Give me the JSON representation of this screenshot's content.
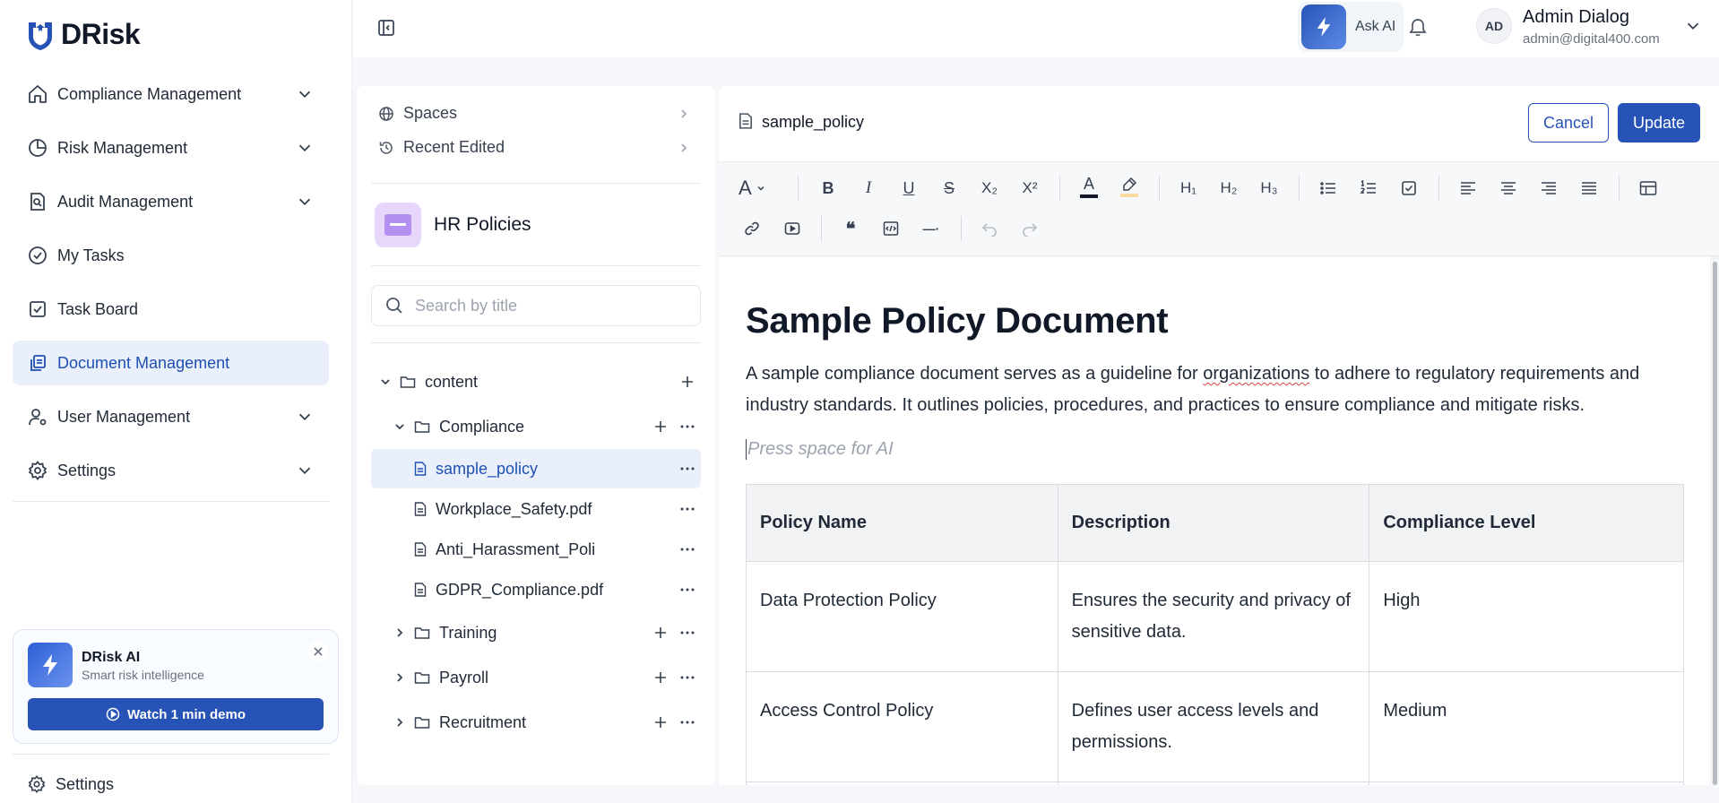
{
  "app": {
    "logo_text": "DRisk"
  },
  "sidebar": {
    "items": [
      {
        "label": "Compliance Management",
        "icon": "home-icon",
        "expandable": true
      },
      {
        "label": "Risk Management",
        "icon": "pie-chart-icon",
        "expandable": true
      },
      {
        "label": "Audit Management",
        "icon": "audit-search-icon",
        "expandable": true
      },
      {
        "label": "My Tasks",
        "icon": "check-circle-icon",
        "expandable": false
      },
      {
        "label": "Task Board",
        "icon": "checkbox-icon",
        "expandable": false
      },
      {
        "label": "Document Management",
        "icon": "documents-icon",
        "expandable": false,
        "active": true
      },
      {
        "label": "User Management",
        "icon": "user-gear-icon",
        "expandable": true
      },
      {
        "label": "Settings",
        "icon": "gear-icon",
        "expandable": true
      }
    ],
    "ai_card": {
      "title": "DRisk AI",
      "subtitle": "Smart risk intelligence",
      "button_label": "Watch 1 min demo"
    },
    "bottom_settings_label": "Settings"
  },
  "topbar": {
    "ask_ai_label": "Ask AI",
    "user": {
      "initials": "AD",
      "name": "Admin Dialog",
      "email": "admin@digital400.com"
    }
  },
  "left_panel": {
    "links": {
      "spaces": "Spaces",
      "recent": "Recent Edited"
    },
    "space_title": "HR Policies",
    "search_placeholder": "Search by title",
    "tree": {
      "root": "content",
      "compliance": "Compliance",
      "files": [
        "sample_policy",
        "Workplace_Safety.pdf",
        "Anti_Harassment_Poli",
        "GDPR_Compliance.pdf"
      ],
      "training": "Training",
      "payroll": "Payroll",
      "recruitment": "Recruitment"
    }
  },
  "editor": {
    "doc_name": "sample_policy",
    "cancel_label": "Cancel",
    "update_label": "Update",
    "toolbar": {
      "font": "A",
      "bold": "B",
      "italic": "I",
      "underline": "U",
      "strike": "S",
      "subscript": "X₂",
      "superscript": "X²",
      "text_color": "A",
      "h1": "H₁",
      "h2": "H₂",
      "h3": "H₃",
      "quote": "❝",
      "hr": "—·"
    },
    "text_color_value": "#111827",
    "highlight_color_value": "#f8d9a0",
    "title": "Sample Policy Document",
    "paragraph_before": "A sample compliance document serves as a guideline for ",
    "paragraph_flagged_word": "organizations",
    "paragraph_after": " to adhere to regulatory requirements and industry standards. It outlines policies, procedures, and practices to ensure compliance and mitigate risks.",
    "placeholder": "Press space for AI",
    "table": {
      "headers": [
        "Policy Name",
        "Description",
        "Compliance Level"
      ],
      "rows": [
        [
          "Data Protection Policy",
          "Ensures the security and privacy of sensitive data.",
          "High"
        ],
        [
          "Access Control Policy",
          "Defines user access levels and permissions.",
          "Medium"
        ]
      ]
    }
  },
  "colors": {
    "accent": "#2753b7",
    "active_bg": "#eaf0fb",
    "active_text": "#1e4fb3"
  }
}
